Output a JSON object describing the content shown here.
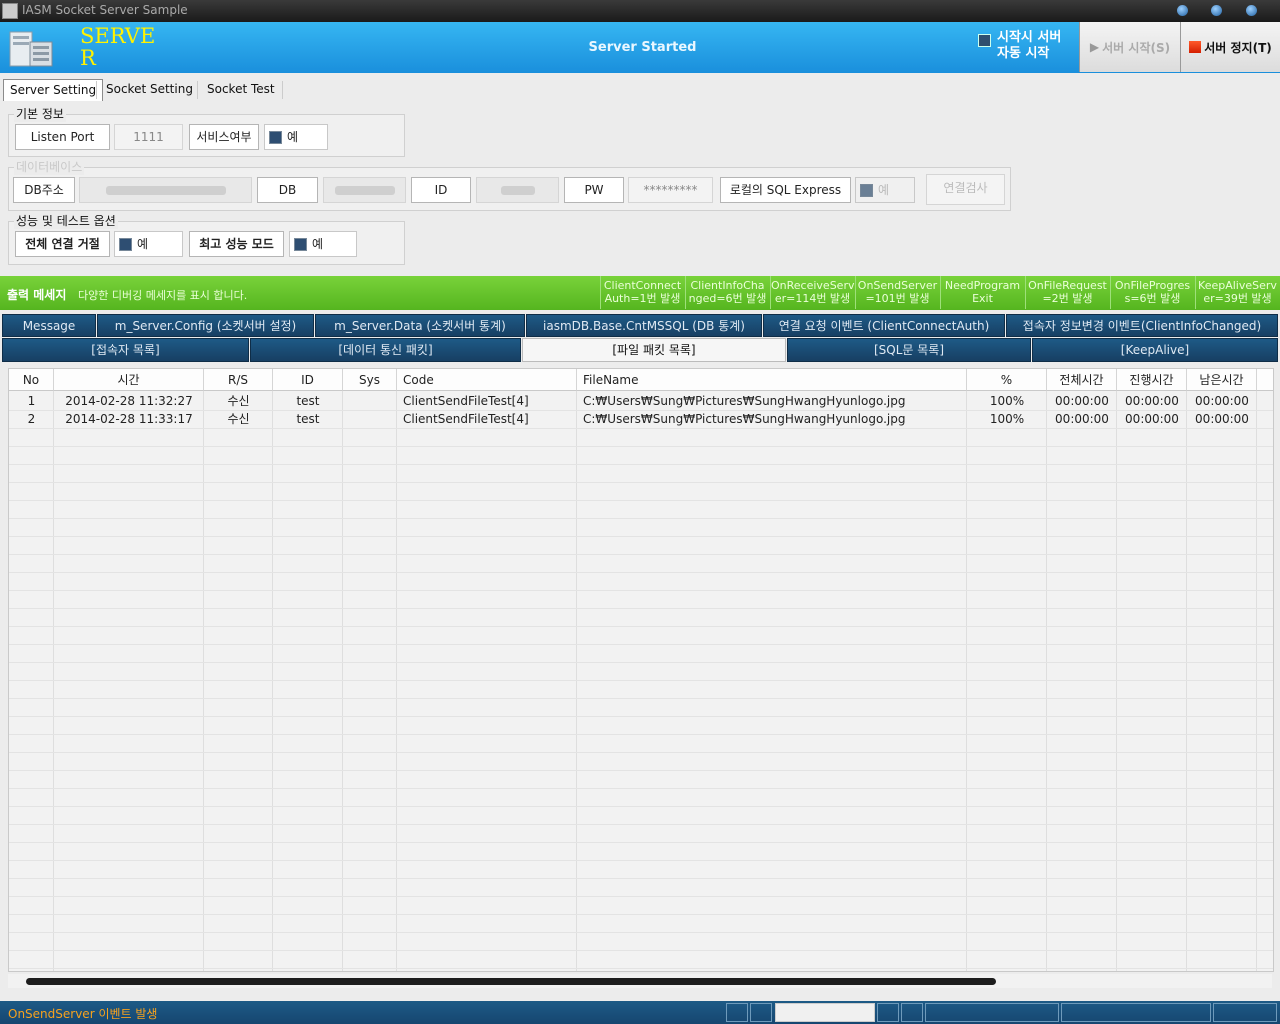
{
  "window": {
    "title": "IASM Socket Server Sample"
  },
  "header": {
    "logo_text": "SERVE\nR",
    "status": "Server Started",
    "autostart_label": "시작시 서버\n자동 시작",
    "start_button": "서버 시작(S)",
    "stop_button": "서버 정지(T)"
  },
  "tabs": [
    "Server Setting",
    "Socket Setting",
    "Socket Test"
  ],
  "basic": {
    "group_title": "기본 정보",
    "listen_port_label": "Listen Port",
    "listen_port_value": "1111",
    "service_label": "서비스여부",
    "service_value": "예"
  },
  "database": {
    "group_title": "데이터베이스",
    "db_addr_label": "DB주소",
    "db_label": "DB",
    "id_label": "ID",
    "pw_label": "PW",
    "pw_value": "*********",
    "local_sql_label": "로컬의 SQL Express",
    "local_sql_value": "예",
    "test_button": "연결검사"
  },
  "perf": {
    "group_title": "성능 및 테스트 옵션",
    "reject_label": "전체 연결 거절",
    "reject_value": "예",
    "max_perf_label": "최고 성능 모드",
    "max_perf_value": "예"
  },
  "output": {
    "title": "출력 메세지",
    "subtitle": "다양한 디버깅 메세지를 표시 합니다.",
    "counters": [
      {
        "l1": "ClientConnect",
        "l2": "Auth=1번 발생"
      },
      {
        "l1": "ClientInfoCha",
        "l2": "nged=6번 발생"
      },
      {
        "l1": "OnReceiveServ",
        "l2": "er=114번 발생"
      },
      {
        "l1": "OnSendServer",
        "l2": "=101번 발생"
      },
      {
        "l1": "NeedProgram",
        "l2": "Exit"
      },
      {
        "l1": "OnFileRequest",
        "l2": "=2번 발생"
      },
      {
        "l1": "OnFileProgres",
        "l2": "s=6번 발생"
      },
      {
        "l1": "KeepAliveServ",
        "l2": "er=39번 발생"
      }
    ]
  },
  "tabs_row1": [
    "Message",
    "m_Server.Config (소켓서버 설정)",
    "m_Server.Data  (소켓서버 통계)",
    "iasmDB.Base.CntMSSQL  (DB 통계)",
    "연결 요청 이벤트 (ClientConnectAuth)",
    "접속자 정보변경 이벤트(ClientInfoChanged)"
  ],
  "tabs_row2": [
    "[접속자 목록]",
    "[데이터 통신 패킷]",
    "[파일 패킷 목록]",
    "[SQL문 목록]",
    "[KeepAlive]"
  ],
  "table": {
    "columns": [
      "No",
      "시간",
      "R/S",
      "ID",
      "Sys",
      "Code",
      "FileName",
      "%",
      "전체시간",
      "진행시간",
      "남은시간"
    ],
    "rows": [
      [
        "1",
        "2014-02-28 11:32:27",
        "수신",
        "test",
        "",
        "ClientSendFileTest[4]",
        "C:₩Users₩Sung₩Pictures₩SungHwangHyunlogo.jpg",
        "100%",
        "00:00:00",
        "00:00:00",
        "00:00:00"
      ],
      [
        "2",
        "2014-02-28 11:33:17",
        "수신",
        "test",
        "",
        "ClientSendFileTest[4]",
        "C:₩Users₩Sung₩Pictures₩SungHwangHyunlogo.jpg",
        "100%",
        "00:00:00",
        "00:00:00",
        "00:00:00"
      ]
    ]
  },
  "status": {
    "message": "OnSendServer 이벤트 발생"
  },
  "colors": {
    "header_blue": "#1a8fdc",
    "output_green": "#55b51f",
    "tab_navy": "#173f63",
    "status_orange": "#f6a21e"
  }
}
